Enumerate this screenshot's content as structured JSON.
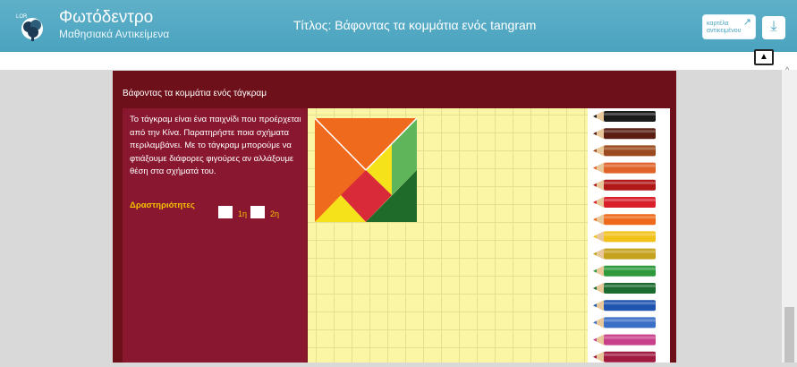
{
  "header": {
    "brand_name": "Φωτόδεντρο",
    "brand_sub": "Μαθησιακά Αντικείμενα",
    "title": "Τίτλος: Βάφοντας τα κομμάτια ενός tangram",
    "card_button": [
      "καρτέλα",
      "αντικειμένου"
    ]
  },
  "activity": {
    "heading": "Βάφοντας τα κομμάτια ενός τάγκραμ",
    "description": "Το τάγκραμ είναι ένα παιχνίδι που προέρχεται από την Κίνα. Παρατηρήστε ποια σχήματα περιλαμβάνει. Με το τάγκραμ μπορούμε να φτιάξουμε διάφορες φιγούρες αν αλλάξουμε θέση στα σχήματά του.",
    "activities_label": "Δραστηριότητες",
    "options": [
      "1η",
      "2η"
    ]
  },
  "colors": {
    "header": "#4aa3bf",
    "frame": "#6e1019",
    "panel": "#8a1730",
    "grid": "#fbf5a6",
    "accent": "#f5c400"
  },
  "tangram_pieces": [
    {
      "name": "orange-large-triangle",
      "color": "#f06a1e"
    },
    {
      "name": "orange-left-triangle",
      "color": "#f06a1e"
    },
    {
      "name": "green-light-parallelogram",
      "color": "#5fb65a"
    },
    {
      "name": "yellow-small-triangle",
      "color": "#f5e21a"
    },
    {
      "name": "red-square",
      "color": "#d92a3a"
    },
    {
      "name": "yellow-corner-triangle",
      "color": "#f5e21a"
    },
    {
      "name": "green-dark-triangle",
      "color": "#1f6b2a"
    }
  ],
  "pencils": [
    "#1a1a1a",
    "#5a1e12",
    "#9a4a1e",
    "#e0632a",
    "#b01818",
    "#d81f2a",
    "#ee6a1a",
    "#f2c21a",
    "#c4a21e",
    "#2e9a3c",
    "#1c6b30",
    "#1f55b0",
    "#3a6fc8",
    "#c8408a",
    "#a01a40",
    "#6a6a6a"
  ]
}
